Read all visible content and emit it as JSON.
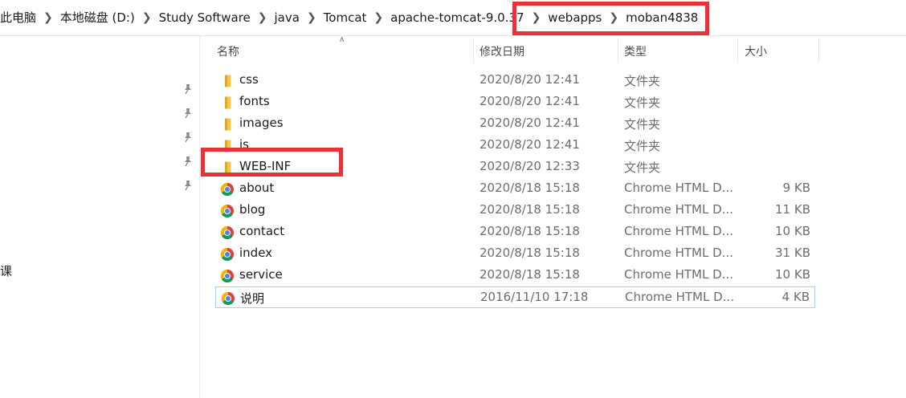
{
  "breadcrumb": [
    "此电脑",
    "本地磁盘 (D:)",
    "Study Software",
    "java",
    "Tomcat",
    "apache-tomcat-9.0.37",
    "webapps",
    "moban4838"
  ],
  "nav": {
    "partial_item": "课"
  },
  "columns": {
    "name": "名称",
    "date": "修改日期",
    "type": "类型",
    "size": "大小"
  },
  "files": [
    {
      "name": "css",
      "date": "2020/8/20 12:41",
      "type": "文件夹",
      "size": "",
      "icon": "folder-icon"
    },
    {
      "name": "fonts",
      "date": "2020/8/20 12:41",
      "type": "文件夹",
      "size": "",
      "icon": "folder-icon"
    },
    {
      "name": "images",
      "date": "2020/8/20 12:41",
      "type": "文件夹",
      "size": "",
      "icon": "folder-icon"
    },
    {
      "name": "js",
      "date": "2020/8/20 12:41",
      "type": "文件夹",
      "size": "",
      "icon": "folder-icon"
    },
    {
      "name": "WEB-INF",
      "date": "2020/8/20 12:33",
      "type": "文件夹",
      "size": "",
      "icon": "folder-icon"
    },
    {
      "name": "about",
      "date": "2020/8/18 15:18",
      "type": "Chrome HTML D...",
      "size": "9 KB",
      "icon": "chrome-icon"
    },
    {
      "name": "blog",
      "date": "2020/8/18 15:18",
      "type": "Chrome HTML D...",
      "size": "11 KB",
      "icon": "chrome-icon"
    },
    {
      "name": "contact",
      "date": "2020/8/18 15:18",
      "type": "Chrome HTML D...",
      "size": "10 KB",
      "icon": "chrome-icon"
    },
    {
      "name": "index",
      "date": "2020/8/18 15:18",
      "type": "Chrome HTML D...",
      "size": "31 KB",
      "icon": "chrome-icon"
    },
    {
      "name": "service",
      "date": "2020/8/18 15:18",
      "type": "Chrome HTML D...",
      "size": "10 KB",
      "icon": "chrome-icon"
    },
    {
      "name": "说明",
      "date": "2016/11/10 17:18",
      "type": "Chrome HTML D...",
      "size": "4 KB",
      "icon": "chrome-icon"
    }
  ],
  "selected_index": 10,
  "colors": {
    "highlight": "#e8323a",
    "selection_border": "#99d1ff",
    "folder": "#f3c745"
  }
}
